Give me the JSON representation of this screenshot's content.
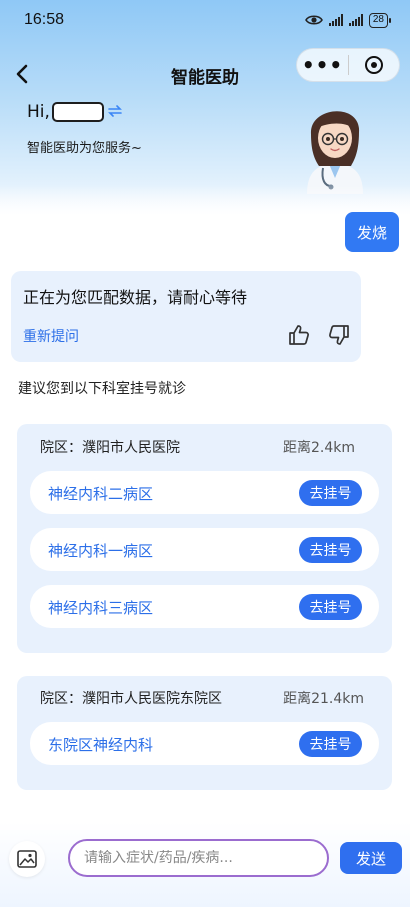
{
  "status_bar": {
    "time": "16:58",
    "battery": "28"
  },
  "nav": {
    "title": "智能医助",
    "more_label": "•••"
  },
  "greeting": {
    "hi": "Hi,",
    "subtitle": "智能医助为您服务~"
  },
  "chat": {
    "user_message": "发烧",
    "bot_message": "正在为您匹配数据，请耐心等待",
    "reask_label": "重新提问",
    "suggestion": "建议您到以下科室挂号就诊"
  },
  "hospitals": [
    {
      "name": "院区：濮阳市人民医院",
      "distance": "距离2.4km",
      "departments": [
        {
          "name": "神经内科二病区",
          "action": "去挂号"
        },
        {
          "name": "神经内科一病区",
          "action": "去挂号"
        },
        {
          "name": "神经内科三病区",
          "action": "去挂号"
        }
      ]
    },
    {
      "name": "院区：濮阳市人民医院东院区",
      "distance": "距离21.4km",
      "departments": [
        {
          "name": "东院区神经内科",
          "action": "去挂号"
        }
      ]
    }
  ],
  "input": {
    "placeholder": "请输入症状/药品/疾病...",
    "value": "",
    "send_label": "发送"
  },
  "colors": {
    "accent": "#2f6fef",
    "link": "#2c6fe8",
    "card_bg": "#e8f1fd",
    "input_border": "#9b6ccf"
  },
  "icons": [
    "eye-icon",
    "signal-icon",
    "battery-icon",
    "back-icon",
    "close-miniprogram-icon",
    "swap-icon",
    "thumbs-up-icon",
    "thumbs-down-icon",
    "image-icon"
  ]
}
